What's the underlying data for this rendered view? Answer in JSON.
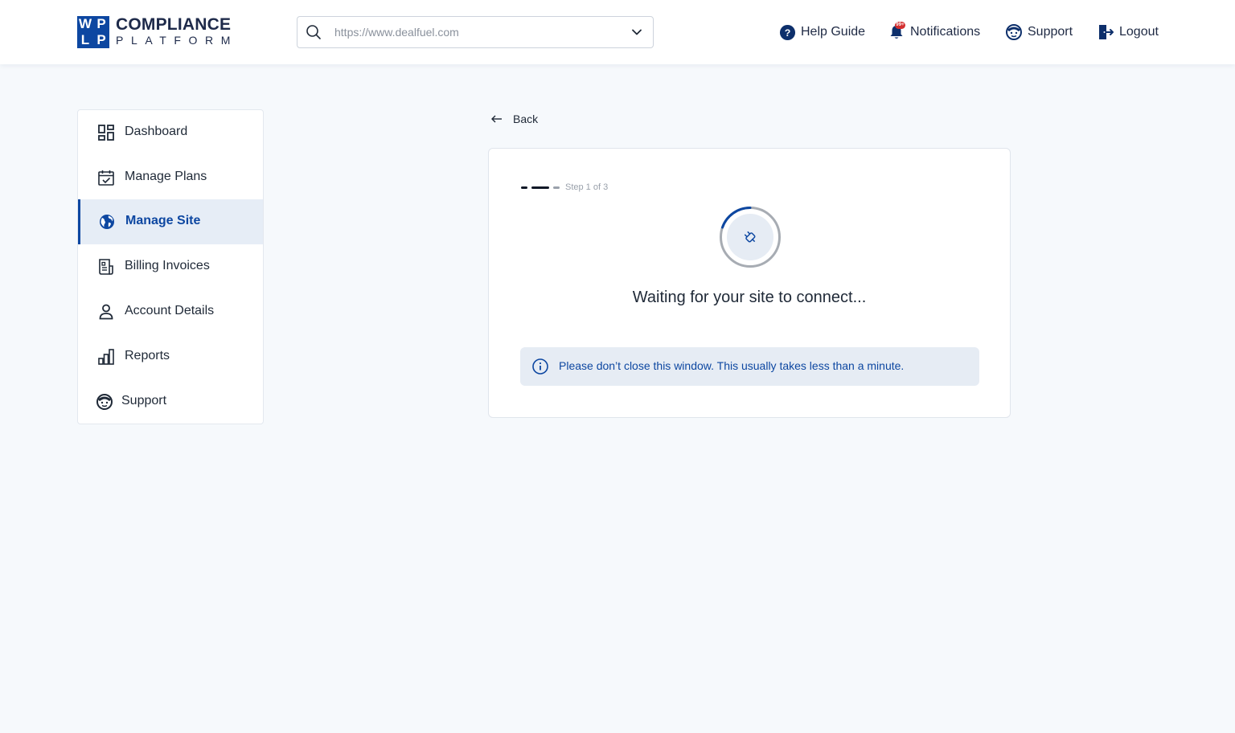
{
  "brand": {
    "mark_letters": [
      "W",
      "P",
      "L",
      "P"
    ],
    "title": "COMPLIANCE",
    "subtitle": "PLATFORM",
    "color": "#0d47a1"
  },
  "site_selector": {
    "value": "https://www.dealfuel.com",
    "icon": "search-icon",
    "dropdown_icon": "chevron-down-icon"
  },
  "top_nav": {
    "help_label": "Help Guide",
    "notifications_label": "Notifications",
    "notifications_badge": "99+",
    "support_label": "Support",
    "logout_label": "Logout"
  },
  "sidebar": {
    "items": [
      {
        "label": "Dashboard",
        "icon": "dashboard-icon"
      },
      {
        "label": "Manage Plans",
        "icon": "calendar-check-icon"
      },
      {
        "label": "Manage Site",
        "icon": "globe-icon",
        "active": true
      },
      {
        "label": "Billing Invoices",
        "icon": "invoice-icon"
      },
      {
        "label": "Account Details",
        "icon": "user-icon"
      },
      {
        "label": "Reports",
        "icon": "bar-chart-icon"
      },
      {
        "label": "Support",
        "icon": "support-icon"
      }
    ]
  },
  "back": {
    "label": "Back"
  },
  "connect_card": {
    "step_text": "Step 1 of 3",
    "status_title": "Waiting for your site to connect...",
    "info_message": "Please don’t close this window. This usually takes less than a minute.",
    "accent_color": "#0d47a1"
  }
}
